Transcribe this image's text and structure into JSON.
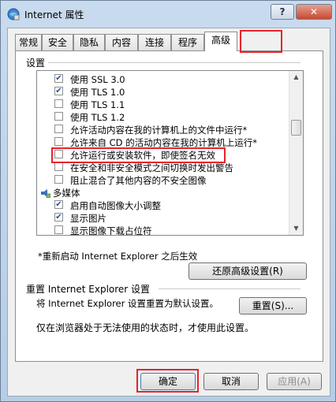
{
  "window": {
    "title": "Internet 属性",
    "help_label": "?",
    "close_label": "✕"
  },
  "tabs": [
    {
      "label": "常规"
    },
    {
      "label": "安全"
    },
    {
      "label": "隐私"
    },
    {
      "label": "内容"
    },
    {
      "label": "连接"
    },
    {
      "label": "程序"
    },
    {
      "label": "高级",
      "active": true
    }
  ],
  "settings": {
    "label": "设置",
    "items": [
      {
        "label": "使用 SSL 3.0",
        "checked": true
      },
      {
        "label": "使用 TLS 1.0",
        "checked": true
      },
      {
        "label": "使用 TLS 1.1",
        "checked": false
      },
      {
        "label": "使用 TLS 1.2",
        "checked": false
      },
      {
        "label": "允许活动内容在我的计算机上的文件中运行*",
        "checked": false
      },
      {
        "label": "允许来自 CD 的活动内容在我的计算机上运行*",
        "checked": false
      },
      {
        "label": "允许运行或安装软件，即使签名无效",
        "checked": false
      },
      {
        "label": "在安全和非安全模式之间切换时发出警告",
        "checked": false
      },
      {
        "label": "阻止混合了其他内容的不安全图像",
        "checked": false
      },
      {
        "label": "多媒体",
        "group": true
      },
      {
        "label": "启用自动图像大小调整",
        "checked": true
      },
      {
        "label": "显示图片",
        "checked": true
      },
      {
        "label": "显示图像下载占位符",
        "checked": false
      }
    ]
  },
  "restart_note": "*重新启动 Internet Explorer 之后生效",
  "restore_button": "还原高级设置(R)",
  "reset": {
    "section_label": "重置 Internet Explorer 设置",
    "description": "将 Internet Explorer 设置重置为默认设置。",
    "button": "重置(S)...",
    "note": "仅在浏览器处于无法使用的状态时，才使用此设置。"
  },
  "footer": {
    "ok": "确定",
    "cancel": "取消",
    "apply": "应用(A)"
  },
  "highlight_color": "#e8232a",
  "icons": {
    "title": "internet-options-icon",
    "group": "multimedia-icon"
  }
}
